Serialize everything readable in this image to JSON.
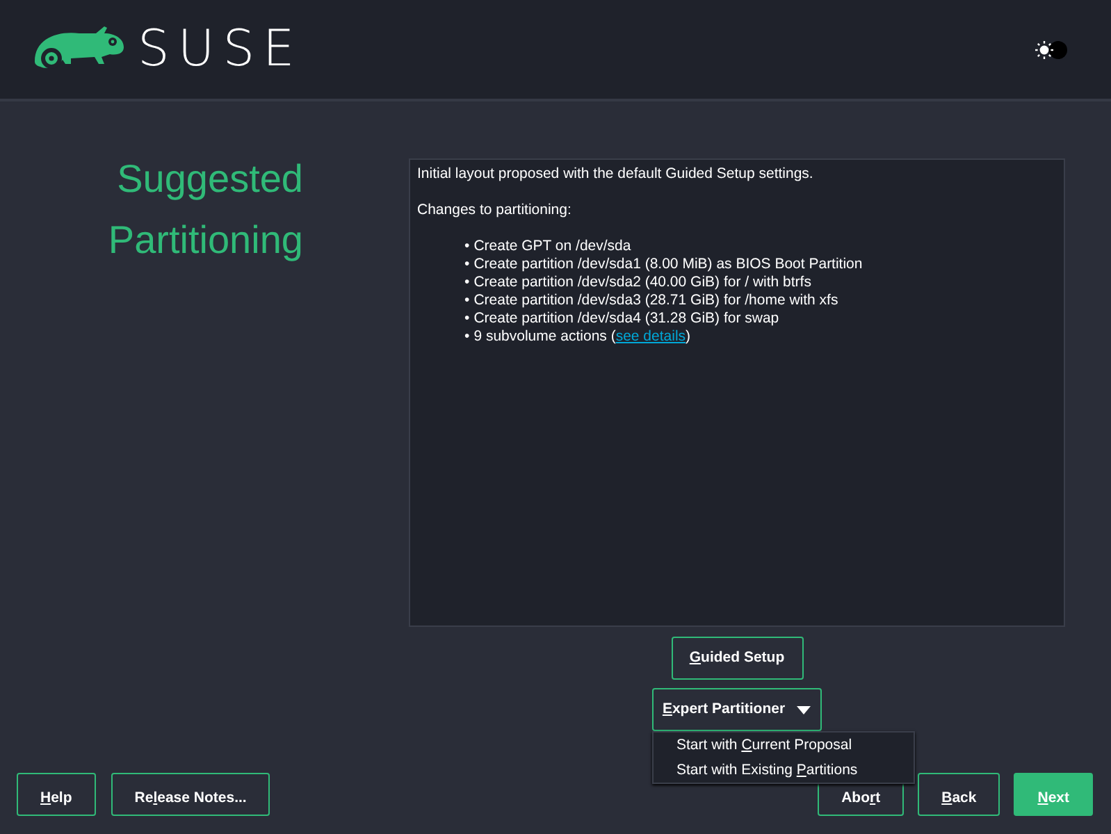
{
  "header": {
    "brand": "SUSE"
  },
  "title": {
    "lines": [
      "Suggested",
      "Partitioning"
    ]
  },
  "summary": {
    "intro": "Initial layout proposed with the default Guided Setup settings.",
    "heading": "Changes to partitioning:",
    "items": [
      {
        "marker": "•",
        "text": "Create GPT on /dev/sda"
      },
      {
        "marker": "•",
        "text": "Create partition /dev/sda1 (8.00 MiB) as BIOS Boot Partition"
      },
      {
        "marker": "•",
        "text": "Create partition /dev/sda2 (40.00 GiB) for / with btrfs"
      },
      {
        "marker": "•",
        "text": "Create partition /dev/sda3 (28.71 GiB) for /home with xfs"
      },
      {
        "marker": "•",
        "text": "Create partition /dev/sda4 (31.28 GiB) for swap"
      },
      {
        "marker": "•",
        "text": "9 subvolume actions (",
        "link": "see details",
        "after": ")"
      }
    ]
  },
  "guided_button": {
    "key": "G",
    "post": "uided Setup"
  },
  "expert_button": {
    "key": "E",
    "post": "xpert Partitioner",
    "expanded": true
  },
  "expert_menu": [
    {
      "pre": "Start with ",
      "key": "C",
      "post": "urrent Proposal"
    },
    {
      "pre": "Start with Existing ",
      "key": "P",
      "post": "artitions"
    }
  ],
  "footer_left": [
    {
      "key": "H",
      "post": "elp",
      "primary": false
    },
    {
      "pre": "Re",
      "key": "l",
      "post": "ease Notes...",
      "primary": false
    }
  ],
  "footer_right": [
    {
      "pre": "Abo",
      "key": "r",
      "post": "t",
      "primary": false
    },
    {
      "key": "B",
      "post": "ack",
      "primary": false
    },
    {
      "key": "N",
      "post": "ext",
      "primary": true
    }
  ]
}
